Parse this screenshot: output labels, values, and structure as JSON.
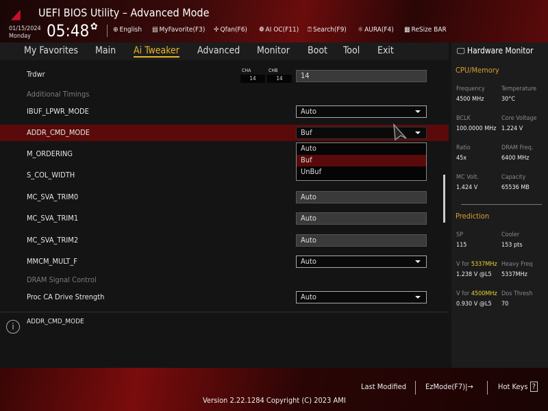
{
  "header": {
    "title": "UEFI BIOS Utility – Advanced Mode",
    "date": "01/15/2024",
    "day": "Monday",
    "time": "05:48",
    "toolbar": [
      {
        "icon": "globe-icon",
        "label": "English"
      },
      {
        "icon": "favorite-icon",
        "label": "MyFavorite(F3)"
      },
      {
        "icon": "fan-icon",
        "label": "Qfan(F6)"
      },
      {
        "icon": "ai-oc-icon",
        "label": "AI OC(F11)"
      },
      {
        "icon": "search-icon",
        "label": "Search(F9)"
      },
      {
        "icon": "aura-icon",
        "label": "AURA(F4)"
      },
      {
        "icon": "resize-bar-icon",
        "label": "ReSize BAR"
      }
    ]
  },
  "nav": {
    "tabs": [
      "My Favorites",
      "Main",
      "Ai Tweaker",
      "Advanced",
      "Monitor",
      "Boot",
      "Tool",
      "Exit"
    ],
    "active": "Ai Tweaker"
  },
  "settings": {
    "trdwr": {
      "label": "Trdwr",
      "cha_label": "CHA",
      "cha": "14",
      "chb_label": "CHB",
      "chb": "14",
      "value": "14"
    },
    "additional_timings": "Additional Timings",
    "ibuf": {
      "label": "IBUF_LPWR_MODE",
      "value": "Auto"
    },
    "addr": {
      "label": "ADDR_CMD_MODE",
      "value": "Buf",
      "options": [
        "Auto",
        "Buf",
        "UnBuf"
      ]
    },
    "m_ordering": {
      "label": "M_ORDERING"
    },
    "s_col": {
      "label": "S_COL_WIDTH"
    },
    "trim0": {
      "label": "MC_SVA_TRIM0",
      "value": "Auto"
    },
    "trim1": {
      "label": "MC_SVA_TRIM1",
      "value": "Auto"
    },
    "trim2": {
      "label": "MC_SVA_TRIM2",
      "value": "Auto"
    },
    "mmcm": {
      "label": "MMCM_MULT_F",
      "value": "Auto"
    },
    "dram_signal": "DRAM Signal Control",
    "proc_ca": {
      "label": "Proc CA Drive Strength",
      "value": "Auto"
    }
  },
  "help": {
    "text": "ADDR_CMD_MODE"
  },
  "hw_monitor": {
    "title": "Hardware Monitor",
    "cpu_memory": "CPU/Memory",
    "items": [
      [
        "Frequency",
        "4500 MHz"
      ],
      [
        "Temperature",
        "30°C"
      ],
      [
        "BCLK",
        "100.0000 MHz"
      ],
      [
        "Core Voltage",
        "1.224 V"
      ],
      [
        "Ratio",
        "45x"
      ],
      [
        "DRAM Freq.",
        "6400 MHz"
      ],
      [
        "MC Volt.",
        "1.424 V"
      ],
      [
        "Capacity",
        "65536 MB"
      ]
    ],
    "prediction": "Prediction",
    "pred": {
      "sp_label": "SP",
      "sp": "115",
      "cooler_label": "Cooler",
      "cooler": "153 pts",
      "vfor": "V for ",
      "f1": "5337MHz",
      "v1": "1.238 V @L5",
      "heavy_label": "Heavy Freq",
      "heavy": "5337MHz",
      "f2": "4500MHz",
      "v2": "0.930 V @L5",
      "dos_label": "Dos Thresh",
      "dos": "70"
    }
  },
  "footer": {
    "last_modified": "Last Modified",
    "ezmode": "EzMode(F7)|→",
    "hotkeys": "Hot Keys",
    "hotkeys_icon": "?",
    "version": "Version 2.22.1284 Copyright (C) 2023 AMI"
  },
  "colors": {
    "accent": "#e8b62a",
    "selected_row": "#5a0a0a",
    "brand_red": "#c8102e"
  }
}
